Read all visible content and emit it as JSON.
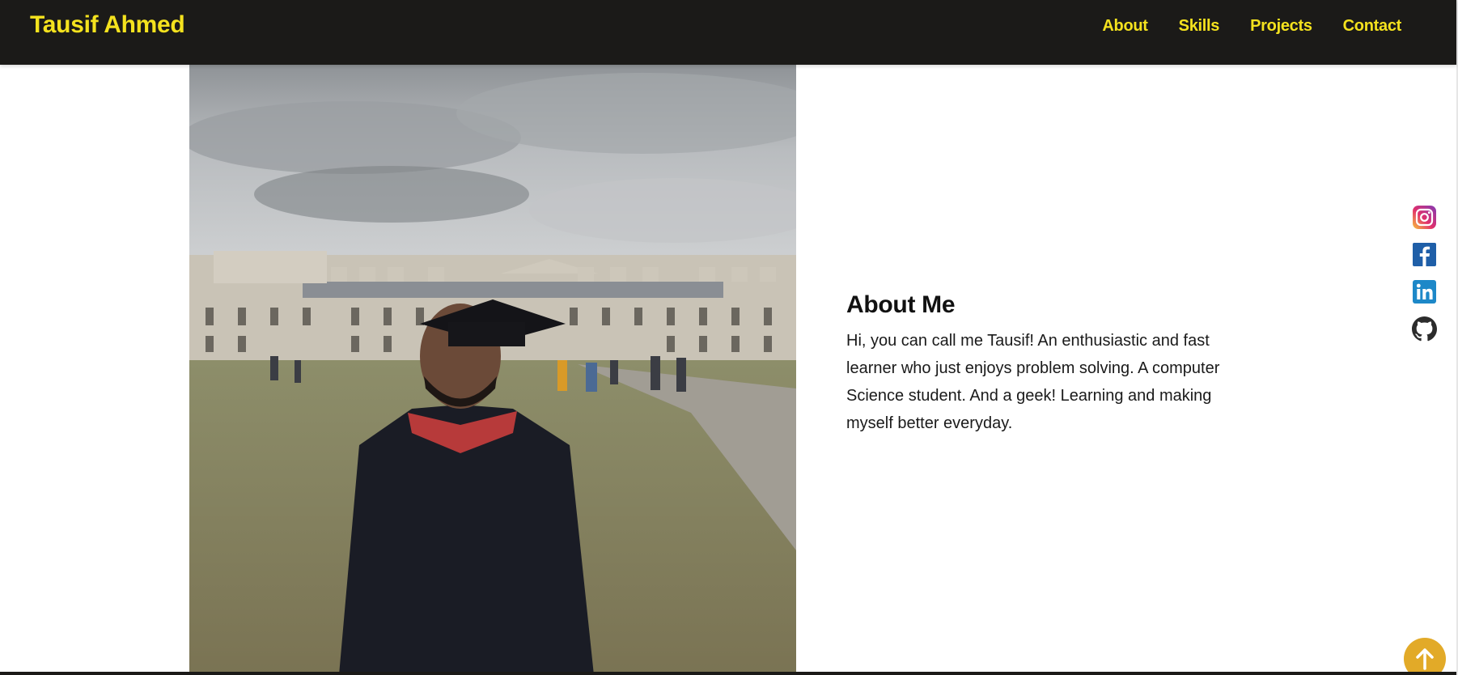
{
  "header": {
    "brand": "Tausif Ahmed",
    "nav": [
      {
        "label": "About"
      },
      {
        "label": "Skills"
      },
      {
        "label": "Projects"
      },
      {
        "label": "Contact"
      }
    ]
  },
  "about": {
    "title": "About Me",
    "body": "Hi, you can call me Tausif! An enthusiastic and fast learner who just enjoys problem solving. A computer Science student. And a geek! Learning and making myself better everyday."
  },
  "social": [
    {
      "icon": "instagram-icon"
    },
    {
      "icon": "facebook-icon"
    },
    {
      "icon": "linkedin-icon"
    },
    {
      "icon": "github-icon"
    }
  ],
  "colors": {
    "header_bg": "#1b1a18",
    "accent_yellow": "#f4e21e",
    "to_top_button": "#e2aa28"
  },
  "to_top": {
    "icon": "arrow-up-icon"
  }
}
